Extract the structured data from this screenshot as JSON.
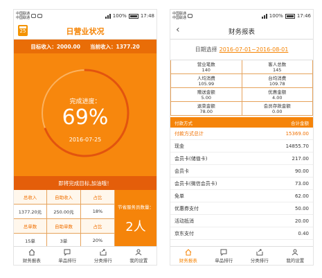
{
  "status_left": {
    "carrier1": "中国联通",
    "carrier2": "中国联通"
  },
  "screen1": {
    "status": {
      "battery": "100%",
      "time": "17:48"
    },
    "title": "日营业状况",
    "calendar_day": "25",
    "target_label": "目标收入：",
    "target_value": "2000.00",
    "current_label": "当前收入：",
    "current_value": "1377.20",
    "progress_label": "完成进度：",
    "progress_text": "69%",
    "progress_value": 0.69,
    "date": "2016-07-25",
    "encourage": "即将完成目标,加油哦！",
    "stats": {
      "row1_headers": [
        "总收入",
        "自助收入",
        "占比"
      ],
      "row1_values": [
        "1377.20元",
        "250.00元",
        "18%"
      ],
      "row2_headers": [
        "总单数",
        "自助单数",
        "占比"
      ],
      "row2_values": [
        "15单",
        "3单",
        "20%"
      ]
    },
    "save_label": "节省服务员数量：",
    "save_value": "2人",
    "tabs": [
      "财务报表",
      "单品排行",
      "分类排行",
      "我的设置"
    ]
  },
  "screen2": {
    "status": {
      "battery": "100%",
      "time": "17:46"
    },
    "title": "财务报表",
    "date_label": "日期选择",
    "date_value": "2016-07-01~2016-08-01",
    "summary": [
      {
        "label": "营业笔数",
        "value": "140"
      },
      {
        "label": "客人总数",
        "value": "145"
      },
      {
        "label": "人均消费",
        "value": "105.99"
      },
      {
        "label": "台均消费",
        "value": "109.78"
      },
      {
        "label": "赠送金额",
        "value": "5.00"
      },
      {
        "label": "优惠金额",
        "value": "4.00"
      },
      {
        "label": "退菜金额",
        "value": "78.00"
      },
      {
        "label": "会员存款金额",
        "value": "0.00"
      }
    ],
    "pay_header": {
      "left": "付款方式",
      "right": "合计金额"
    },
    "payments": [
      {
        "name": "付款方式总计",
        "amount": "15369.00"
      },
      {
        "name": "现金",
        "amount": "14855.70"
      },
      {
        "name": "会员卡(储值卡)",
        "amount": "217.00"
      },
      {
        "name": "会员卡",
        "amount": "90.00"
      },
      {
        "name": "会员卡(微信会员卡)",
        "amount": "73.00"
      },
      {
        "name": "免单",
        "amount": "62.00"
      },
      {
        "name": "优惠券支付",
        "amount": "50.00"
      },
      {
        "name": "活动抵消",
        "amount": "20.00"
      },
      {
        "name": "京东支付",
        "amount": "0.40"
      }
    ],
    "tabs": [
      "财务报表",
      "单品排行",
      "分类排行",
      "我的设置"
    ]
  },
  "colors": {
    "accent": "#f5840a",
    "accent_dark": "#e45e0a",
    "border": "#e6a25a"
  }
}
